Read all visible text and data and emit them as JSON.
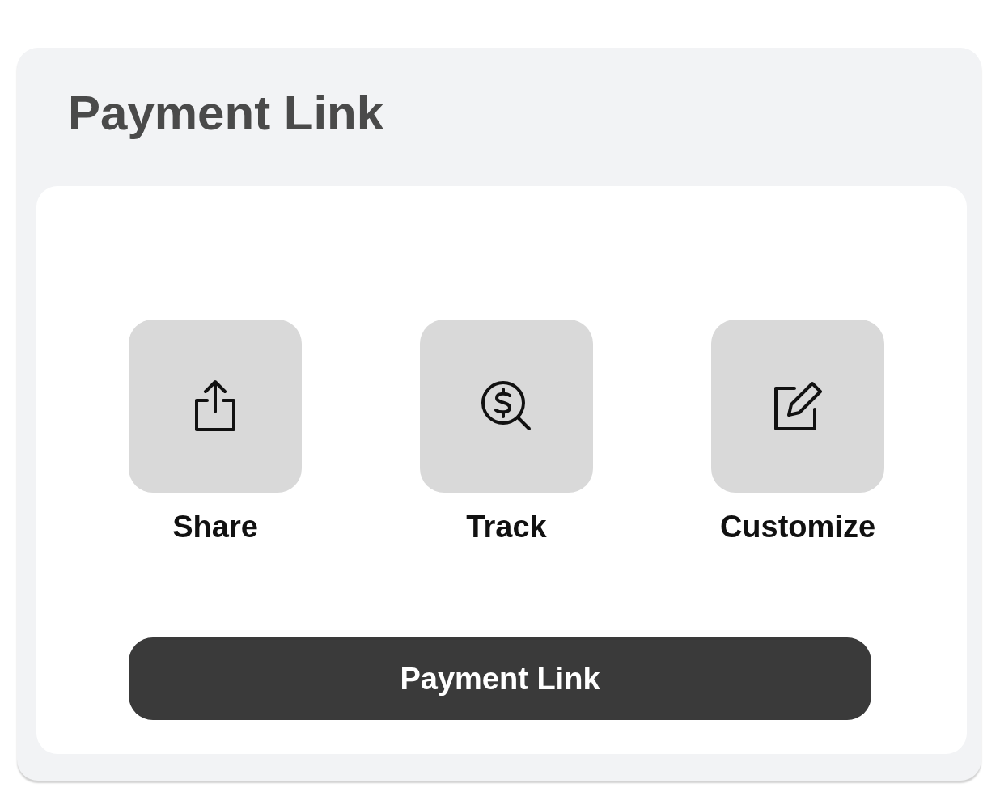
{
  "card": {
    "title": "Payment Link"
  },
  "actions": [
    {
      "kind": "share",
      "label": "Share"
    },
    {
      "kind": "track",
      "label": "Track"
    },
    {
      "kind": "customize",
      "label": "Customize"
    }
  ],
  "button": {
    "label": "Payment Link"
  }
}
